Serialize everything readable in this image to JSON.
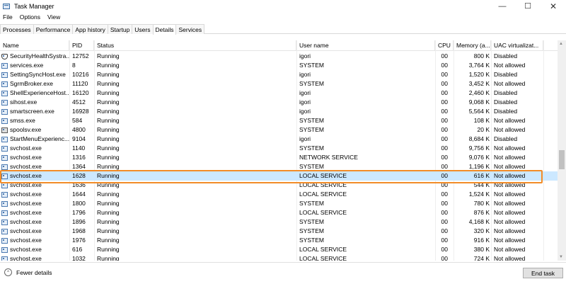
{
  "window": {
    "title": "Task Manager",
    "minimize_glyph": "—",
    "maximize_glyph": "☐",
    "close_glyph": "✕"
  },
  "menu": [
    "File",
    "Options",
    "View"
  ],
  "tabs": [
    "Processes",
    "Performance",
    "App history",
    "Startup",
    "Users",
    "Details",
    "Services"
  ],
  "active_tab": "Details",
  "columns": {
    "name": "Name",
    "pid": "PID",
    "status": "Status",
    "user": "User name",
    "cpu": "CPU",
    "memory": "Memory (a...",
    "uac": "UAC virtualizat..."
  },
  "sort_indicator": "^",
  "rows": [
    {
      "icon": "shield-icon",
      "name": "SecurityHealthSystra...",
      "pid": "12752",
      "status": "Running",
      "user": "igori",
      "cpu": "00",
      "memory": "800 K",
      "uac": "Disabled"
    },
    {
      "icon": "process-icon",
      "name": "services.exe",
      "pid": "8",
      "status": "Running",
      "user": "SYSTEM",
      "cpu": "00",
      "memory": "3,764 K",
      "uac": "Not allowed"
    },
    {
      "icon": "process-icon",
      "name": "SettingSyncHost.exe",
      "pid": "10216",
      "status": "Running",
      "user": "igori",
      "cpu": "00",
      "memory": "1,520 K",
      "uac": "Disabled"
    },
    {
      "icon": "process-icon",
      "name": "SgrmBroker.exe",
      "pid": "11120",
      "status": "Running",
      "user": "SYSTEM",
      "cpu": "00",
      "memory": "3,452 K",
      "uac": "Not allowed"
    },
    {
      "icon": "process-icon",
      "name": "ShellExperienceHost....",
      "pid": "16120",
      "status": "Running",
      "user": "igori",
      "cpu": "00",
      "memory": "2,460 K",
      "uac": "Disabled"
    },
    {
      "icon": "process-icon",
      "name": "sihost.exe",
      "pid": "4512",
      "status": "Running",
      "user": "igori",
      "cpu": "00",
      "memory": "9,068 K",
      "uac": "Disabled"
    },
    {
      "icon": "process-icon",
      "name": "smartscreen.exe",
      "pid": "16928",
      "status": "Running",
      "user": "igori",
      "cpu": "00",
      "memory": "5,564 K",
      "uac": "Disabled"
    },
    {
      "icon": "process-icon",
      "name": "smss.exe",
      "pid": "584",
      "status": "Running",
      "user": "SYSTEM",
      "cpu": "00",
      "memory": "108 K",
      "uac": "Not allowed"
    },
    {
      "icon": "printer-icon",
      "name": "spoolsv.exe",
      "pid": "4800",
      "status": "Running",
      "user": "SYSTEM",
      "cpu": "00",
      "memory": "20 K",
      "uac": "Not allowed"
    },
    {
      "icon": "process-icon",
      "name": "StartMenuExperienc...",
      "pid": "9104",
      "status": "Running",
      "user": "igori",
      "cpu": "00",
      "memory": "8,684 K",
      "uac": "Disabled"
    },
    {
      "icon": "process-icon",
      "name": "svchost.exe",
      "pid": "1140",
      "status": "Running",
      "user": "SYSTEM",
      "cpu": "00",
      "memory": "9,756 K",
      "uac": "Not allowed"
    },
    {
      "icon": "process-icon",
      "name": "svchost.exe",
      "pid": "1316",
      "status": "Running",
      "user": "NETWORK SERVICE",
      "cpu": "00",
      "memory": "9,076 K",
      "uac": "Not allowed"
    },
    {
      "icon": "process-icon",
      "name": "svchost.exe",
      "pid": "1364",
      "status": "Running",
      "user": "SYSTEM",
      "cpu": "00",
      "memory": "1,196 K",
      "uac": "Not allowed"
    },
    {
      "icon": "process-icon",
      "name": "svchost.exe",
      "pid": "1628",
      "status": "Running",
      "user": "LOCAL SERVICE",
      "cpu": "00",
      "memory": "616 K",
      "uac": "Not allowed",
      "selected": true
    },
    {
      "icon": "process-icon",
      "name": "svchost.exe",
      "pid": "1636",
      "status": "Running",
      "user": "LOCAL SERVICE",
      "cpu": "00",
      "memory": "544 K",
      "uac": "Not allowed"
    },
    {
      "icon": "process-icon",
      "name": "svchost.exe",
      "pid": "1644",
      "status": "Running",
      "user": "LOCAL SERVICE",
      "cpu": "00",
      "memory": "1,524 K",
      "uac": "Not allowed"
    },
    {
      "icon": "process-icon",
      "name": "svchost.exe",
      "pid": "1800",
      "status": "Running",
      "user": "SYSTEM",
      "cpu": "00",
      "memory": "780 K",
      "uac": "Not allowed"
    },
    {
      "icon": "process-icon",
      "name": "svchost.exe",
      "pid": "1796",
      "status": "Running",
      "user": "LOCAL SERVICE",
      "cpu": "00",
      "memory": "876 K",
      "uac": "Not allowed"
    },
    {
      "icon": "process-icon",
      "name": "svchost.exe",
      "pid": "1896",
      "status": "Running",
      "user": "SYSTEM",
      "cpu": "00",
      "memory": "4,168 K",
      "uac": "Not allowed"
    },
    {
      "icon": "process-icon",
      "name": "svchost.exe",
      "pid": "1968",
      "status": "Running",
      "user": "SYSTEM",
      "cpu": "00",
      "memory": "320 K",
      "uac": "Not allowed"
    },
    {
      "icon": "process-icon",
      "name": "svchost.exe",
      "pid": "1976",
      "status": "Running",
      "user": "SYSTEM",
      "cpu": "00",
      "memory": "916 K",
      "uac": "Not allowed"
    },
    {
      "icon": "process-icon",
      "name": "svchost.exe",
      "pid": "616",
      "status": "Running",
      "user": "LOCAL SERVICE",
      "cpu": "00",
      "memory": "380 K",
      "uac": "Not allowed"
    },
    {
      "icon": "process-icon",
      "name": "svchost.exe",
      "pid": "1032",
      "status": "Running",
      "user": "LOCAL SERVICE",
      "cpu": "00",
      "memory": "724 K",
      "uac": "Not allowed"
    }
  ],
  "footer": {
    "fewer_details": "Fewer details",
    "fewer_glyph": "⌃",
    "end_task": "End task"
  },
  "colors": {
    "selection": "#cce8ff",
    "highlight_outline": "#f28c28"
  }
}
